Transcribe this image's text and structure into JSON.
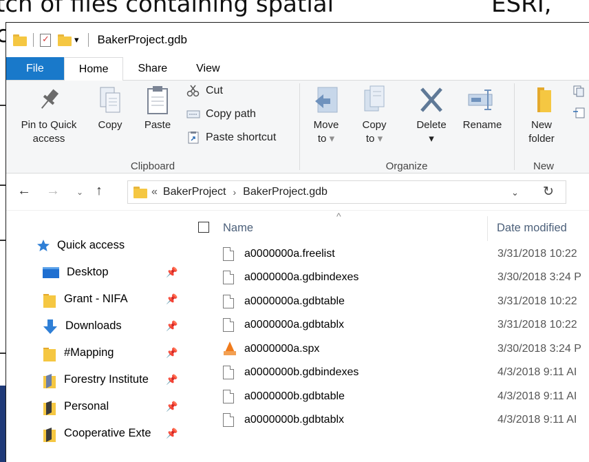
{
  "background_slide": {
    "top_text_left": "tch of files containing spatial",
    "top_text_right": "ESRI,",
    "left_fragment": "c"
  },
  "window": {
    "title": "BakerProject.gdb",
    "quick_access_dropdown": "▾"
  },
  "tabs": [
    {
      "label": "File"
    },
    {
      "label": "Home"
    },
    {
      "label": "Share"
    },
    {
      "label": "View"
    }
  ],
  "ribbon": {
    "clipboard": {
      "label": "Clipboard",
      "pin_line1": "Pin to Quick",
      "pin_line2": "access",
      "copy": "Copy",
      "paste": "Paste",
      "cut": "Cut",
      "copy_path": "Copy path",
      "paste_shortcut": "Paste shortcut"
    },
    "organize": {
      "label": "Organize",
      "move_line1": "Move",
      "move_line2": "to",
      "copy_line1": "Copy",
      "copy_line2": "to",
      "delete": "Delete",
      "rename": "Rename"
    },
    "new": {
      "label": "New",
      "new_folder_line1": "New",
      "new_folder_line2": "folder"
    }
  },
  "address": {
    "overflow": "«",
    "crumbs": [
      "BakerProject",
      "BakerProject.gdb"
    ]
  },
  "nav": [
    {
      "label": "Quick access",
      "icon": "star-icon",
      "pinned": false
    },
    {
      "label": "Desktop",
      "icon": "desktop-icon",
      "pinned": true
    },
    {
      "label": "Grant - NIFA",
      "icon": "folder-icon",
      "pinned": true
    },
    {
      "label": "Downloads",
      "icon": "download-arrow-icon",
      "pinned": true
    },
    {
      "label": "#Mapping",
      "icon": "folder-icon",
      "pinned": true
    },
    {
      "label": "Forestry Institute",
      "icon": "folder-special-icon",
      "pinned": true
    },
    {
      "label": "Personal",
      "icon": "folder-special-icon",
      "pinned": true
    },
    {
      "label": "Cooperative Exte",
      "icon": "folder-special-icon",
      "pinned": true
    }
  ],
  "columns": {
    "name": "Name",
    "date_modified": "Date modified"
  },
  "files": [
    {
      "name": "a0000000a.freelist",
      "date": "3/31/2018 10:22",
      "icon": "file-icon"
    },
    {
      "name": "a0000000a.gdbindexes",
      "date": "3/30/2018 3:24 P",
      "icon": "file-icon"
    },
    {
      "name": "a0000000a.gdbtable",
      "date": "3/31/2018 10:22",
      "icon": "file-icon"
    },
    {
      "name": "a0000000a.gdbtablx",
      "date": "3/31/2018 10:22",
      "icon": "file-icon"
    },
    {
      "name": "a0000000a.spx",
      "date": "3/30/2018 3:24 P",
      "icon": "vlc-cone-icon"
    },
    {
      "name": "a0000000b.gdbindexes",
      "date": "4/3/2018 9:11 AI",
      "icon": "file-icon"
    },
    {
      "name": "a0000000b.gdbtable",
      "date": "4/3/2018 9:11 AI",
      "icon": "file-icon"
    },
    {
      "name": "a0000000b.gdbtablx",
      "date": "4/3/2018 9:11 AI",
      "icon": "file-icon"
    }
  ],
  "colors": {
    "file_tab": "#1979ca",
    "folder": "#f5c742",
    "header_text": "#4c607a"
  }
}
